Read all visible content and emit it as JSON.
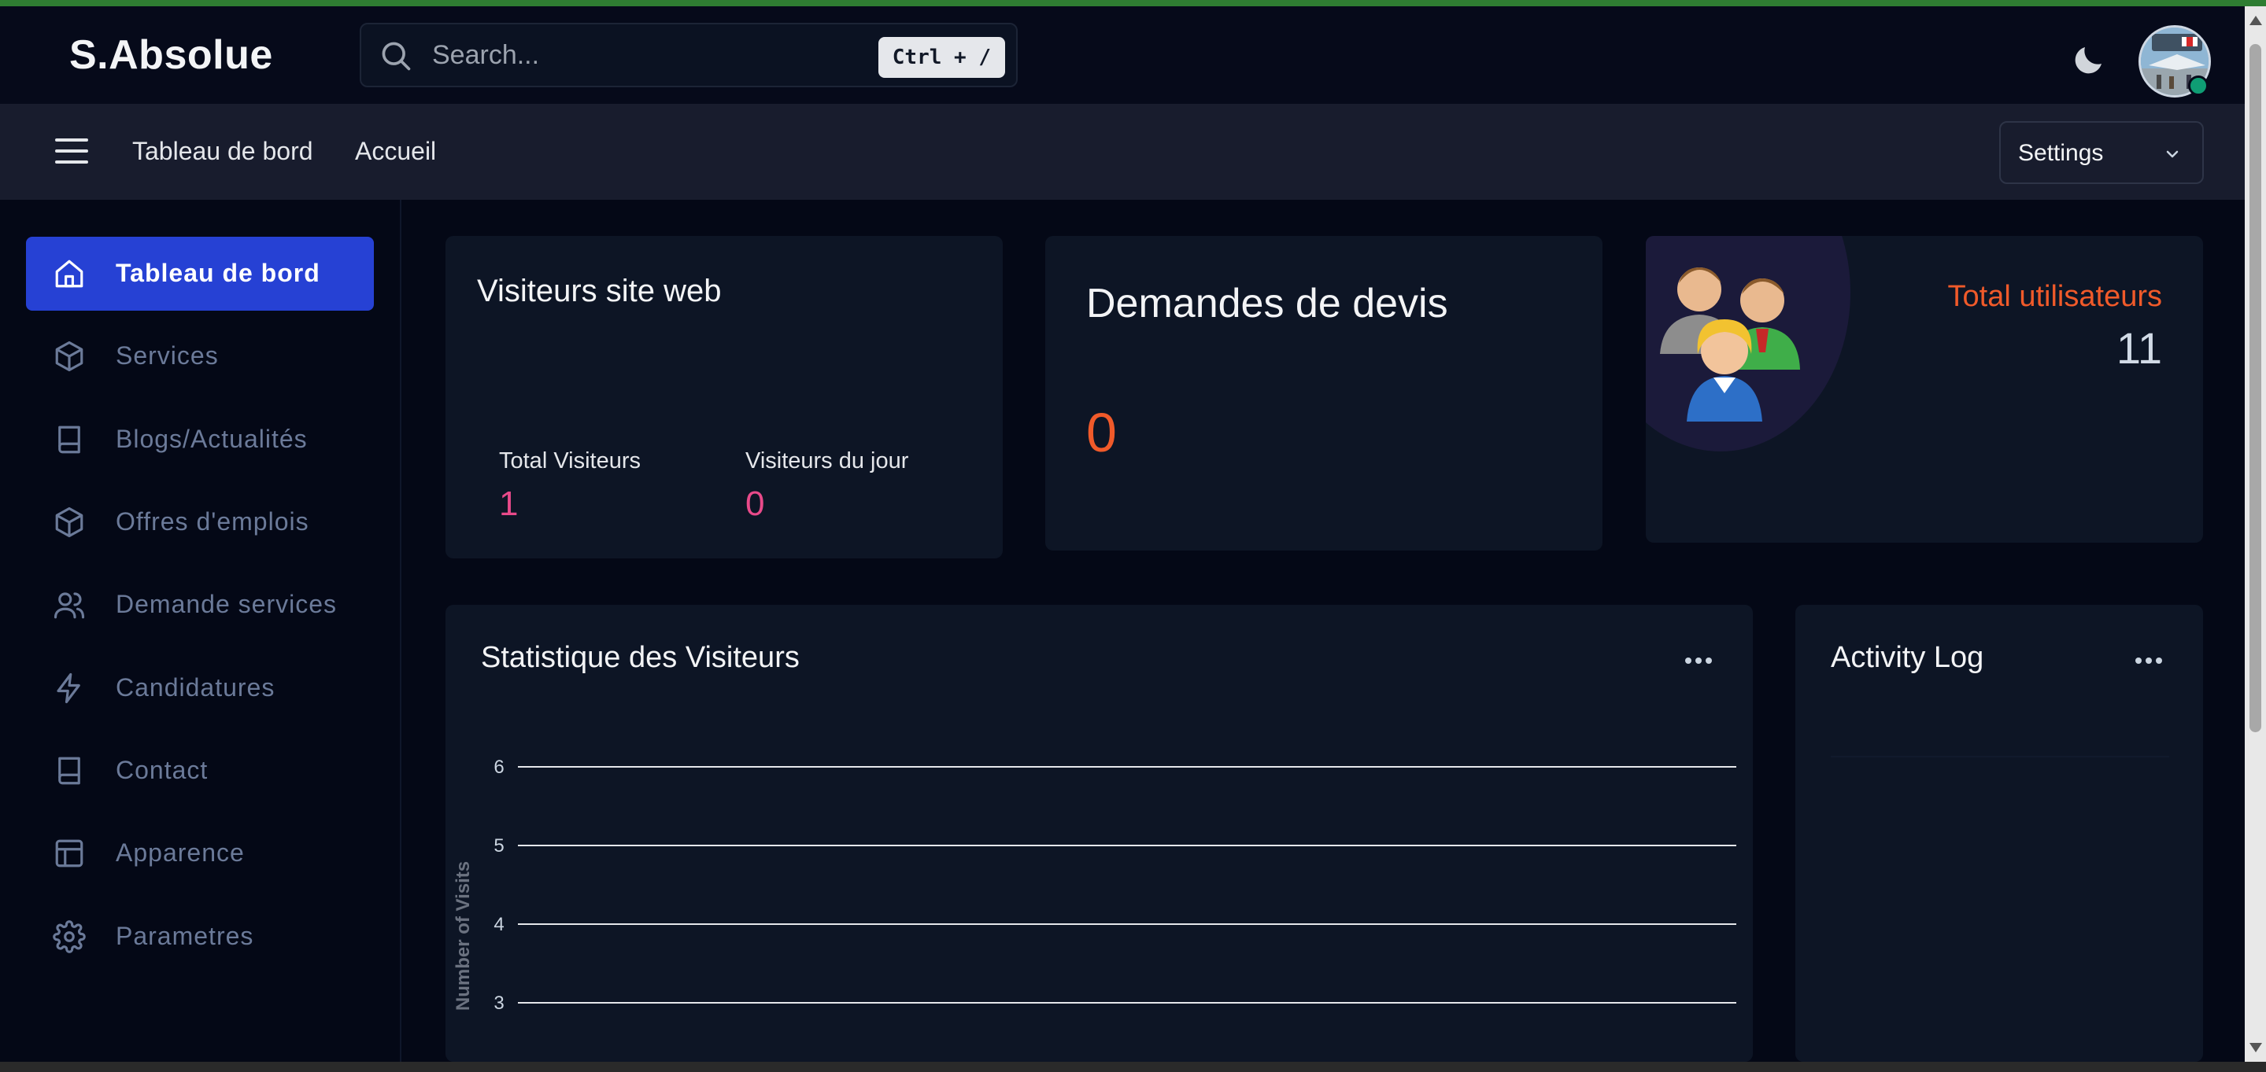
{
  "header": {
    "brand": "S.Absolue",
    "search_placeholder": "Search...",
    "search_shortcut": "Ctrl + /",
    "theme_icon": "moon-icon",
    "avatar_status_color": "#0f9d74"
  },
  "subheader": {
    "breadcrumbs": [
      "Tableau de bord",
      "Accueil"
    ],
    "settings_label": "Settings"
  },
  "sidebar": {
    "accent": "#2641d4",
    "items": [
      {
        "label": "Tableau de bord",
        "icon": "home-icon",
        "active": true
      },
      {
        "label": "Services",
        "icon": "cube-icon"
      },
      {
        "label": "Blogs/Actualités",
        "icon": "book-icon"
      },
      {
        "label": "Offres d'emplois",
        "icon": "cube-icon"
      },
      {
        "label": "Demande services",
        "icon": "users-icon"
      },
      {
        "label": "Candidatures",
        "icon": "lightning-icon"
      },
      {
        "label": "Contact",
        "icon": "book-icon"
      },
      {
        "label": "Apparence",
        "icon": "layout-icon"
      },
      {
        "label": "Parametres",
        "icon": "gear-icon"
      }
    ]
  },
  "cards": {
    "visitors": {
      "title": "Visiteurs site web",
      "total_label": "Total Visiteurs",
      "total_value": "1",
      "today_label": "Visiteurs du jour",
      "today_value": "0"
    },
    "quotes": {
      "title": "Demandes de devis",
      "value": "0"
    },
    "users": {
      "label": "Total utilisateurs",
      "value": "11"
    }
  },
  "stats_panel": {
    "title": "Statistique des Visiteurs"
  },
  "activity_panel": {
    "title": "Activity Log"
  },
  "chart_data": {
    "type": "line",
    "title": "",
    "ylabel": "Number of Visits",
    "yticks": [
      "6",
      "5",
      "4",
      "3"
    ],
    "ylim": [
      3,
      6
    ],
    "grid": true,
    "series": []
  }
}
